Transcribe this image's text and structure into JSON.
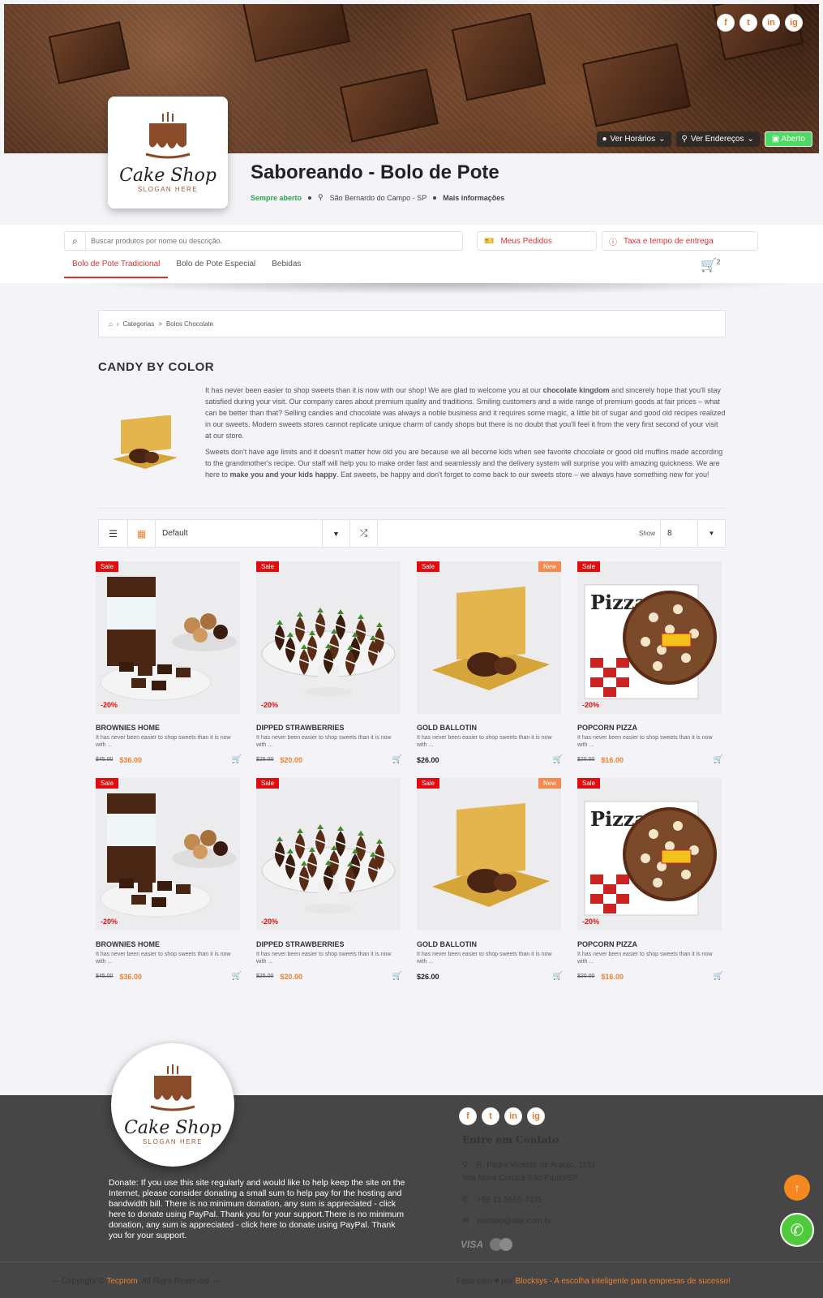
{
  "hero": {
    "social": [
      "f",
      "t",
      "in",
      "ig"
    ],
    "ver_horarios": "Ver Horários",
    "ver_enderecos": "Ver Endereços",
    "status_badge": "Aberto"
  },
  "store": {
    "logo_name": "Cake Shop",
    "logo_slogan": "SLOGAN HERE",
    "title": "Saboreando - Bolo de Pote",
    "open_status": "Sempre aberto",
    "location": "São Bernardo do Campo - SP",
    "more_info": "Mais informações"
  },
  "navbar": {
    "search_placeholder": "Buscar produtos por nome ou descrição.",
    "orders_label": "Meus Pedidos",
    "delivery_label": "Taxa e tempo de entrega",
    "tabs": [
      "Bolo de Pote Tradicional",
      "Bolo de Pote Especial",
      "Bebidas"
    ],
    "cart_count": "2"
  },
  "breadcrumb": {
    "categories": "Categorias",
    "current": "Bolos Chocolate"
  },
  "category": {
    "title": "CANDY BY COLOR",
    "p1_a": "It has never been easier to shop sweets than it is now with our shop! We are glad to welcome you at our ",
    "p1_b": "chocolate kingdom",
    "p1_c": " and sincerely hope that you'll stay satisfied during your visit. Our company cares about premium quality and traditions. Smiling customers and a wide range of premium goods at fair prices – what can be better than that? Selling candies and chocolate was always a noble business and it requires some magic, a little bit of sugar and good old recipes realized in our sweets. Modern sweets stores cannot replicate unique charm of candy shops but there is no doubt that you'll feel it from the very first second of your visit at our store.",
    "p2_a": "Sweets don't have age limits and it doesn't matter how old you are because we all become kids when see favorite chocolate or good old muffins made according to the grandmother's recipe. Our staff will help you to make order fast and seamlessly and the delivery system will surprise you with amazing quickness. We are here to ",
    "p2_b": "make you and your kids happy",
    "p2_c": ". Eat sweets, be happy and don't forget to come back to our sweets store – we always have something new for you!"
  },
  "toolbar": {
    "sort_value": "Default",
    "show_label": "Show",
    "show_value": "8"
  },
  "products": [
    {
      "name": "BROWNIES HOME",
      "desc": "It has never been easier to shop sweets than it is now with ...",
      "old_price": "$45.00",
      "price": "$36.00",
      "sale": "Sale",
      "new": "",
      "discount": "-20%",
      "kind": "brownies"
    },
    {
      "name": "DIPPED STRAWBERRIES",
      "desc": "It has never been easier to shop sweets than it is now with ...",
      "old_price": "$25.00",
      "price": "$20.00",
      "sale": "Sale",
      "new": "",
      "discount": "-20%",
      "kind": "strawberries"
    },
    {
      "name": "GOLD BALLOTIN",
      "desc": "It has never been easier to shop sweets than it is now with ...",
      "old_price": "",
      "price": "$26.00",
      "sale": "Sale",
      "new": "New",
      "discount": "",
      "kind": "gold"
    },
    {
      "name": "POPCORN PIZZA",
      "desc": "It has never been easier to shop sweets than it is now with ...",
      "old_price": "$20.00",
      "price": "$16.00",
      "sale": "Sale",
      "new": "",
      "discount": "-20%",
      "kind": "pizza"
    },
    {
      "name": "BROWNIES HOME",
      "desc": "It has never been easier to shop sweets than it is now with ...",
      "old_price": "$45.00",
      "price": "$36.00",
      "sale": "Sale",
      "new": "",
      "discount": "-20%",
      "kind": "brownies"
    },
    {
      "name": "DIPPED STRAWBERRIES",
      "desc": "It has never been easier to shop sweets than it is now with ...",
      "old_price": "$25.00",
      "price": "$20.00",
      "sale": "Sale",
      "new": "",
      "discount": "-20%",
      "kind": "strawberries"
    },
    {
      "name": "GOLD BALLOTIN",
      "desc": "It has never been easier to shop sweets than it is now with ...",
      "old_price": "",
      "price": "$26.00",
      "sale": "Sale",
      "new": "New",
      "discount": "",
      "kind": "gold"
    },
    {
      "name": "POPCORN PIZZA",
      "desc": "It has never been easier to shop sweets than it is now with ...",
      "old_price": "$20.00",
      "price": "$16.00",
      "sale": "Sale",
      "new": "",
      "discount": "-20%",
      "kind": "pizza"
    }
  ],
  "footer": {
    "logo_name": "Cake Shop",
    "logo_slogan": "SLOGAN HERE",
    "donate": "Donate: If you use this site regularly and would like to help keep the site on the Internet, please consider donating a small sum to help pay for the hosting and bandwidth bill. There is no minimum donation, any sum is appreciated - click here to donate using PayPal. Thank you for your support.There is no minimum donation, any sum is appreciated - click here to donate using PayPal. Thank you for your support.",
    "social": [
      "f",
      "t",
      "in",
      "ig"
    ],
    "contact_title": "Entre em Contato",
    "address_1": "R. Padre Vicente de Araujo, 1151",
    "address_2": "Vila Nova Curuçá São Paulo/SP",
    "phone": "+55 11 5555-7475",
    "email": "contato@site.com.br",
    "visa": "VISA",
    "copyright_a": "— Copyright © ",
    "copyright_brand": "Tecprom",
    "copyright_b": ", All Right Reserved. —",
    "made_a": "Feito com ♥ por ",
    "made_brand": "Blocksys - A escolha inteligente para empresas de sucesso!"
  },
  "colors": {
    "accent": "#f08030",
    "sale_red": "#e30b0b",
    "nav_red": "#dd3333",
    "open_green": "#4cd964",
    "footer_bg": "#464646"
  }
}
